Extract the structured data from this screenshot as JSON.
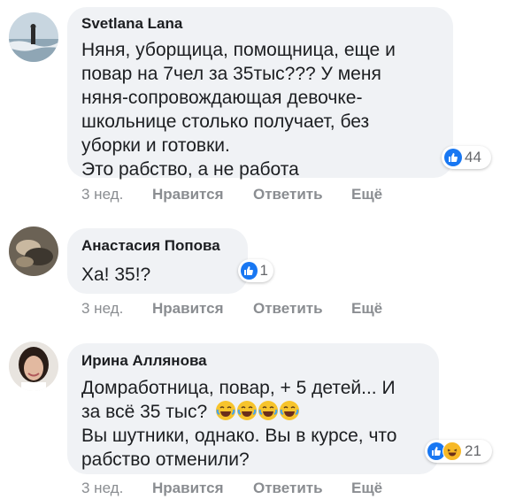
{
  "comments": [
    {
      "author": "Svetlana Lana",
      "text": "Няня, уборщица, помощница, еще и\nповар на 7чел за 35тыс??? У меня\nняня-сопровождающая девочке-\nшкольнице столько получает, без\nуборки и готовки.\nЭто рабство, а не работа",
      "reactions": {
        "count": "44",
        "types": [
          "like-icon"
        ]
      },
      "time": "3 нед.",
      "like": "Нравится",
      "reply": "Ответить",
      "more": "Ещё"
    },
    {
      "author": "Анастасия Попова",
      "text": "Ха! 35!?",
      "reactions": {
        "count": "1",
        "types": [
          "like-icon"
        ]
      },
      "time": "3 нед.",
      "like": "Нравится",
      "reply": "Ответить",
      "more": "Ещё"
    },
    {
      "author": "Ирина Аллянова",
      "text_line1": "Домработница, повар, + 5 детей... И",
      "text_line2": "за всё 35 тыс?",
      "text_rest": "Вы шутники, однако. Вы в курсе, что\nрабство отменили?",
      "inline_emojis": [
        "tears-of-joy-emoji",
        "tears-of-joy-emoji",
        "tears-of-joy-emoji",
        "tears-of-joy-emoji"
      ],
      "reactions": {
        "count": "21",
        "types": [
          "like-icon",
          "haha-icon"
        ]
      },
      "time": "3 нед.",
      "like": "Нравится",
      "reply": "Ответить",
      "more": "Ещё"
    }
  ],
  "colors": {
    "bubble": "#f0f2f5",
    "like": "#1877f2",
    "meta": "#8a8d91",
    "haha": "#f7b928"
  }
}
